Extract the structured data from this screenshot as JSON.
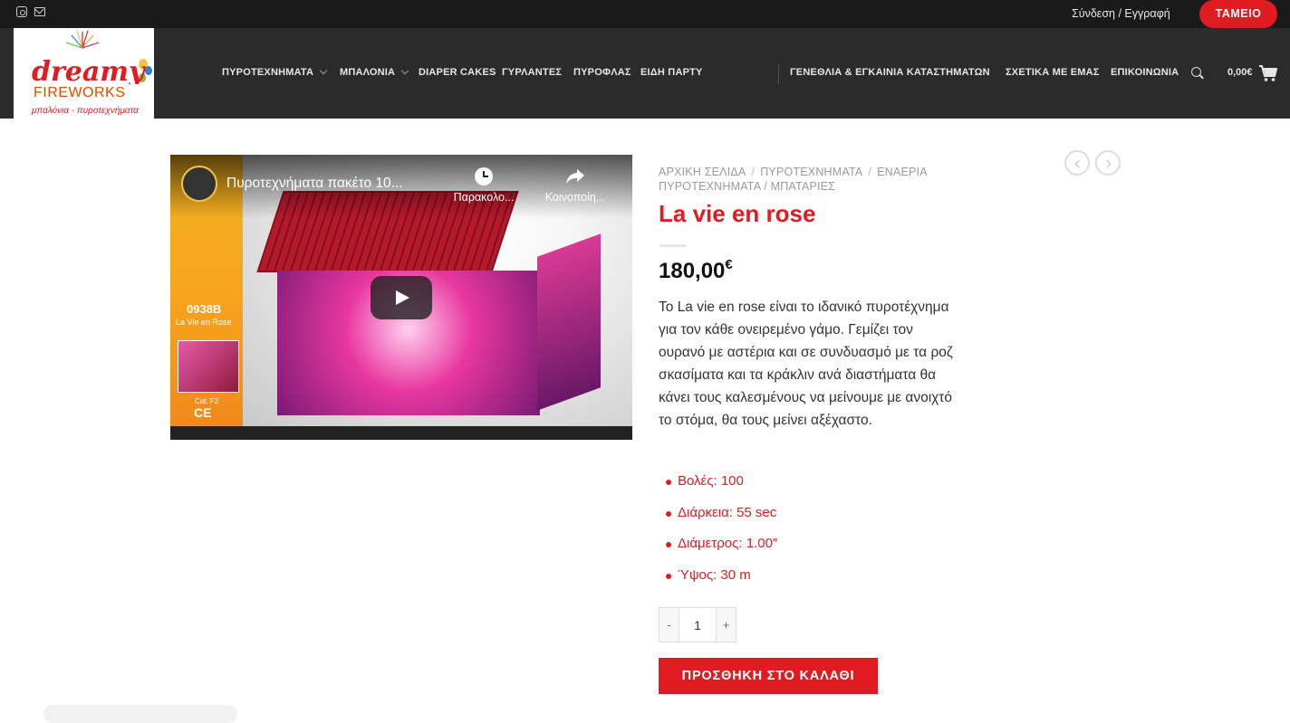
{
  "topbar": {
    "social_icons": [
      "instagram-icon",
      "envelope-icon"
    ],
    "login_label": "Σύνδεση / Εγγραφή",
    "checkout_label": "ΤΑΜΕΙΟ"
  },
  "header": {
    "logo_text": "dreamy FIREWORKS",
    "logo_tagline": "μπαλόνια - πυροτεχνήματα",
    "nav_left": [
      {
        "label": "ΠΥΡΟΤΕΧΝΗΜΑΤΑ",
        "has_dropdown": true
      },
      {
        "label": "ΜΠΑΛΟΝΙΑ",
        "has_dropdown": true
      },
      {
        "label": "DIAPER CAKES",
        "has_dropdown": false
      },
      {
        "label": "ΓΥΡΛΑΝΤΕΣ",
        "has_dropdown": false
      },
      {
        "label": "ΠΥΡΟΦΛΑΣ",
        "has_dropdown": false
      },
      {
        "label": "ΕΙΔΗ ΠΑΡΤΥ",
        "has_dropdown": false
      }
    ],
    "nav_right": [
      {
        "label": "ΓΕΝΕΘΛΙΑ & ΕΓΚΑΙΝΙΑ ΚΑΤΑΣΤΗΜΑΤΩΝ"
      },
      {
        "label": "ΣΧΕΤΙΚΑ ΜΕ ΕΜΑΣ"
      },
      {
        "label": "ΕΠΙΚΟΙΝΩΝΙΑ"
      }
    ],
    "cart_total": "0,00€"
  },
  "video": {
    "title": "Πυροτεχνήματα πακέτο 10...",
    "watch_later_label": "Παρακολο...",
    "share_label": "Κοινοποίη...",
    "product_code": "0938B",
    "product_name": "La Vie en Rose",
    "category": "Cat. F2",
    "ce_mark": "CE"
  },
  "breadcrumb": [
    "ΑΡΧΙΚΗ ΣΕΛΙΔΑ",
    "ΠΥΡΟΤΕΧΝΗΜΑΤΑ",
    "ΕΝΑΕΡΙΑ ΠΥΡΟΤΕΧΝΗΜΑΤΑ / ΜΠΑΤΑΡΙΕΣ"
  ],
  "product": {
    "title": "La vie en rose",
    "price": "180,00",
    "currency": "€",
    "description": "Το La vie en rose είναι το ιδανικό πυροτέχνημα για τον κάθε ονειρεμένο γάμο. Γεμίζει τον ουρανό με αστέρια και σε συνδυασμό με τα ροζ σκασίματα και τα κράκλιν ανά διαστήματα θα κάνει τους καλεσμένους να μείνουμε με ανοιχτό το στόμα, θα τους μείνει αξέχαστο.",
    "specs": [
      "Βολές: 100",
      "Διάρκεια: 55 sec",
      "Διάμετρος: 1.00″",
      "Ύψος: 30 m"
    ],
    "quantity": "1",
    "qty_minus": "-",
    "qty_plus": "+",
    "add_to_cart_label": "ΠΡΟΣΘΗΚΗ ΣΤΟ ΚΑΛΑΘΙ"
  },
  "colors": {
    "accent": "#e11b22",
    "topbar_bg": "#1a1a1a",
    "header_bg": "#2b2b2b"
  }
}
